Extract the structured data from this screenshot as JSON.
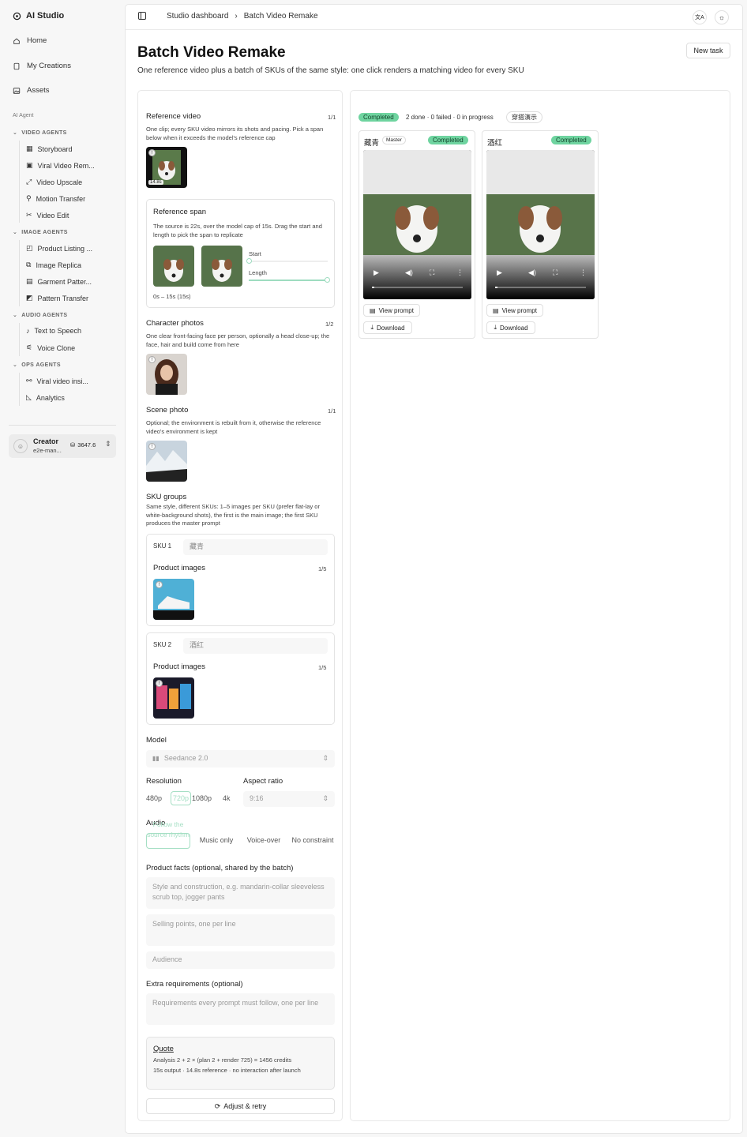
{
  "sidebar": {
    "brand": "AI Studio",
    "nav": [
      "Home",
      "My Creations",
      "Assets"
    ],
    "section_label": "AI Agent",
    "groups": [
      {
        "label": "VIDEO AGENTS",
        "items": [
          "Storyboard",
          "Viral Video Rem...",
          "Video Upscale",
          "Motion Transfer",
          "Video Edit"
        ]
      },
      {
        "label": "IMAGE AGENTS",
        "items": [
          "Product Listing ...",
          "Image Replica",
          "Garment Patter...",
          "Pattern Transfer"
        ]
      },
      {
        "label": "AUDIO AGENTS",
        "items": [
          "Text to Speech",
          "Voice Clone"
        ]
      },
      {
        "label": "OPS AGENTS",
        "items": [
          "Viral video insi...",
          "Analytics"
        ]
      }
    ],
    "user": {
      "name": "Creator",
      "sub": "e2e-man...",
      "credits": "3647.6"
    }
  },
  "breadcrumb": {
    "root": "Studio dashboard",
    "current": "Batch Video Remake"
  },
  "page": {
    "title": "Batch Video Remake",
    "subtitle": "One reference video plus a batch of SKUs of the same style: one click renders a matching video for every SKU",
    "new_task": "New task"
  },
  "form": {
    "ref_video": {
      "label": "Reference video",
      "count": "1/1",
      "help": "One clip; every SKU video mirrors its shots and pacing. Pick a span below when it exceeds the model's reference cap",
      "duration": "14.8s"
    },
    "ref_span": {
      "label": "Reference span",
      "help": "The source is 22s, over the model cap of 15s. Drag the start and length to pick the span to replicate",
      "start": "Start",
      "length": "Length",
      "range": "0s – 15s (15s)",
      "start_value": 0,
      "length_value": 15
    },
    "character": {
      "label": "Character photos",
      "count": "1/2",
      "help": "One clear front-facing face per person, optionally a head close-up; the face, hair and build come from here"
    },
    "scene": {
      "label": "Scene photo",
      "count": "1/1",
      "help": "Optional; the environment is rebuilt from it, otherwise the reference video's environment is kept"
    },
    "sku_groups": {
      "label": "SKU groups",
      "help": "Same style, different SKUs: 1–5 images per SKU (prefer flat-lay or white-background shots), the first is the main image; the first SKU produces the master prompt"
    },
    "skus": [
      {
        "tag": "SKU 1",
        "name": "藏青",
        "images_label": "Product images",
        "count": "1/5"
      },
      {
        "tag": "SKU 2",
        "name": "酒红",
        "images_label": "Product images",
        "count": "1/5"
      }
    ],
    "model": {
      "label": "Model",
      "value": "Seedance 2.0"
    },
    "resolution": {
      "label": "Resolution",
      "options": [
        "480p",
        "720p",
        "1080p",
        "4k"
      ],
      "selected": "720p"
    },
    "aspect": {
      "label": "Aspect ratio",
      "value": "9:16"
    },
    "audio": {
      "label": "Audio",
      "options": [
        "Follow the source rhythm",
        "Music only",
        "Voice-over",
        "No constraint"
      ]
    },
    "facts": {
      "label": "Product facts (optional, shared by the batch)",
      "placeholder1": "Style and construction, e.g. mandarin-collar sleeveless scrub top, jogger pants",
      "placeholder2": "Selling points, one per line",
      "placeholder3": "Audience"
    },
    "extra": {
      "label": "Extra requirements (optional)",
      "placeholder": "Requirements every prompt must follow, one per line"
    },
    "quote": {
      "title": "Quote",
      "line1": "Analysis 2 + 2 × (plan 2 + render 725) = 1456 credits",
      "line2": "15s output · 14.8s reference · no interaction after launch"
    },
    "retry": "Adjust & retry"
  },
  "results": {
    "status": "Completed",
    "summary": "2 done · 0 failed · 0 in progress",
    "demo_tag": "穿搭演示",
    "cards": [
      {
        "name": "藏青",
        "master": "Master",
        "status": "Completed",
        "view_prompt": "View prompt",
        "download": "Download"
      },
      {
        "name": "酒红",
        "status": "Completed",
        "view_prompt": "View prompt",
        "download": "Download"
      }
    ]
  }
}
